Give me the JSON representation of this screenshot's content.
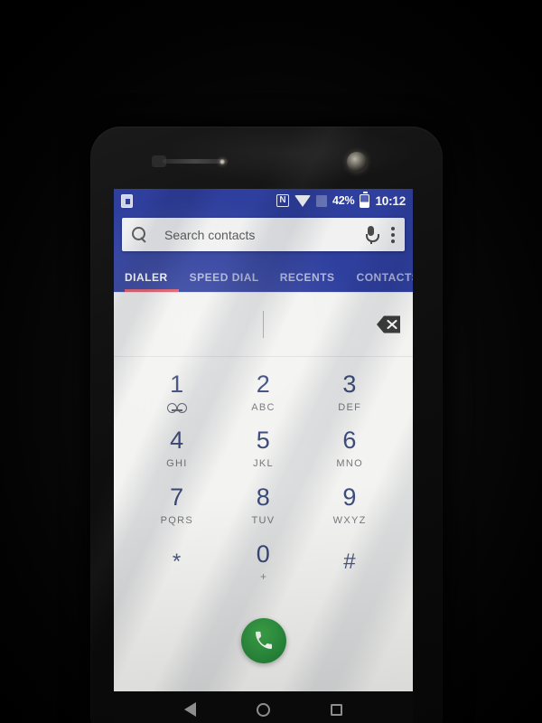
{
  "device": {
    "label": "android-smartphone",
    "hardware": {
      "earpiece": "earpiece-speaker",
      "front_camera": "front-camera",
      "sensor_left": "proximity-sensor",
      "sensor_indicator": "notification-led"
    }
  },
  "status_bar": {
    "left_icons": [
      {
        "name": "sd-card-icon",
        "label": "SD"
      }
    ],
    "right_icons": [
      {
        "name": "nfc-icon",
        "glyph": "N"
      },
      {
        "name": "wifi-icon",
        "glyph": ""
      },
      {
        "name": "signal-icon",
        "glyph": ""
      }
    ],
    "battery_percent": "42%",
    "clock": "10:12"
  },
  "search": {
    "placeholder": "Search contacts",
    "value": "",
    "search_icon": "search-icon",
    "mic_icon": "microphone-icon",
    "overflow_icon": "more-options-icon"
  },
  "tabs": {
    "active_index": 0,
    "items": [
      {
        "label": "DIALER"
      },
      {
        "label": "SPEED DIAL"
      },
      {
        "label": "RECENTS"
      },
      {
        "label": "CONTACTS"
      }
    ]
  },
  "dialpad": {
    "number_value": "",
    "backspace_icon": "backspace-icon",
    "keys": [
      {
        "digit": "1",
        "sub": "",
        "icon": "voicemail-icon"
      },
      {
        "digit": "2",
        "sub": "ABC",
        "icon": ""
      },
      {
        "digit": "3",
        "sub": "DEF",
        "icon": ""
      },
      {
        "digit": "4",
        "sub": "GHI",
        "icon": ""
      },
      {
        "digit": "5",
        "sub": "JKL",
        "icon": ""
      },
      {
        "digit": "6",
        "sub": "MNO",
        "icon": ""
      },
      {
        "digit": "7",
        "sub": "PQRS",
        "icon": ""
      },
      {
        "digit": "8",
        "sub": "TUV",
        "icon": ""
      },
      {
        "digit": "9",
        "sub": "WXYZ",
        "icon": ""
      },
      {
        "digit": "*",
        "sub": "",
        "icon": ""
      },
      {
        "digit": "0",
        "sub": "+",
        "icon": ""
      },
      {
        "digit": "#",
        "sub": "",
        "icon": ""
      }
    ],
    "call_button": {
      "name": "call-button",
      "icon": "phone-handset-icon"
    }
  },
  "nav_bar": {
    "back": "back-button",
    "home": "home-button",
    "recents": "recents-button"
  },
  "colors": {
    "app_bar_blue": "#2f3f9e",
    "tab_indicator": "#e05a6b",
    "call_green": "#2e9340",
    "digit_blue": "#3e4d7d",
    "screen_bg": "#f3f3f1"
  }
}
